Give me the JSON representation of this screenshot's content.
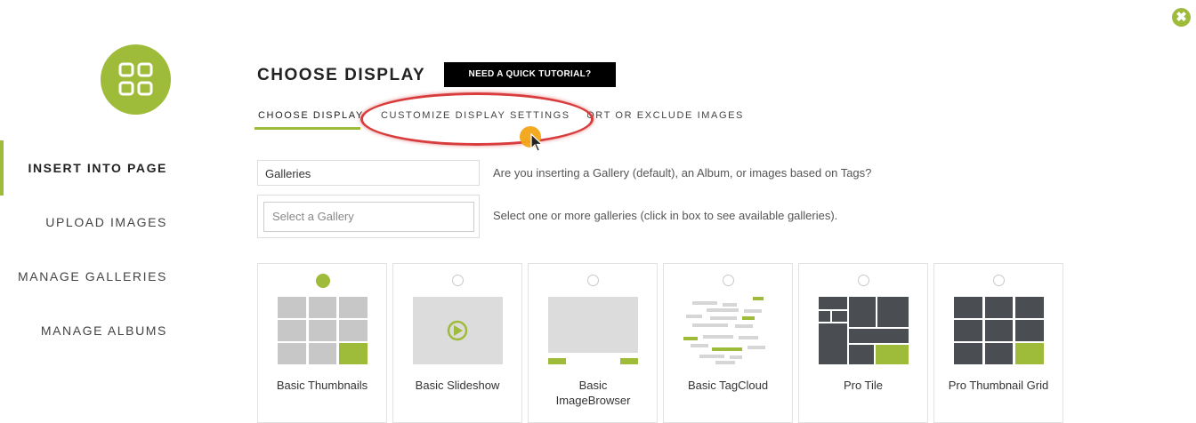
{
  "close_label": "✖",
  "sidebar": {
    "items": [
      {
        "label": "INSERT INTO PAGE",
        "active": true
      },
      {
        "label": "UPLOAD IMAGES",
        "active": false
      },
      {
        "label": "MANAGE GALLERIES",
        "active": false
      },
      {
        "label": "MANAGE ALBUMS",
        "active": false
      }
    ]
  },
  "header": {
    "title": "CHOOSE DISPLAY",
    "tutorial_button": "NEED A QUICK TUTORIAL?"
  },
  "tabs": [
    {
      "label": "CHOOSE DISPLAY",
      "active": true
    },
    {
      "label": "CUSTOMIZE DISPLAY SETTINGS",
      "active": false
    },
    {
      "label": "SORT OR EXCLUDE IMAGES",
      "active": false
    }
  ],
  "form": {
    "type_select_value": "Galleries",
    "type_help": "Are you inserting a Gallery (default), an Album, or images based on Tags?",
    "gallery_placeholder": "Select a Gallery",
    "gallery_help": "Select one or more galleries (click in box to see available galleries)."
  },
  "display_types": [
    {
      "label": "Basic Thumbnails",
      "selected": true
    },
    {
      "label": "Basic Slideshow",
      "selected": false
    },
    {
      "label": "Basic ImageBrowser",
      "selected": false
    },
    {
      "label": "Basic TagCloud",
      "selected": false
    },
    {
      "label": "Pro Tile",
      "selected": false
    },
    {
      "label": "Pro Thumbnail Grid",
      "selected": false
    }
  ],
  "colors": {
    "accent": "#9fbb3a",
    "highlight_ring": "#d93c3c",
    "cursor_dot": "#f2a516"
  }
}
